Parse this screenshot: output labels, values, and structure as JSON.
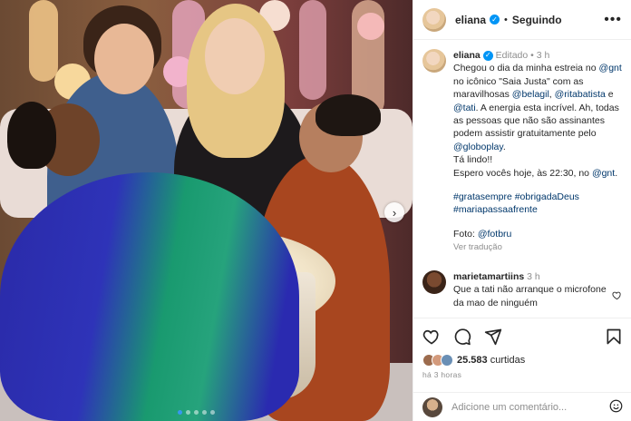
{
  "post": {
    "author": "eliana",
    "follow_status": "Seguindo",
    "more_label": "•••",
    "separator": "•"
  },
  "caption": {
    "author": "eliana",
    "edited_label": "Editado",
    "time": "3 h",
    "line1_pre": "Chegou o dia da minha estreia no ",
    "mention_gnt": "@gnt",
    "line1_mid": " no icônico \"Saia Justa\" com as maravilhosas ",
    "mention_belagil": "@belagil",
    "comma": ", ",
    "mention_ritabatista": "@ritabatista",
    "and": " e ",
    "mention_tati": "@tati",
    "line1_post": ". A energia esta incrível. Ah, todas as pessoas que não são assinantes podem assistir gratuitamente pelo ",
    "mention_globoplay": "@globoplay",
    "period": ".",
    "line2": "Tá lindo!!",
    "line3_pre": "Espero vocês hoje, às 22:30, no ",
    "line3_mention": "@gnt",
    "line3_post": ".",
    "hashtags_1": "#gratasempre #obrigadaDeus",
    "hashtags_2": "#mariapassaafrente",
    "photo_credit_pre": "Foto: ",
    "photo_credit_mention": "@fotbru",
    "see_translation": "Ver tradução"
  },
  "comment": {
    "user": "marietamartiins",
    "time": "3 h",
    "text": "Que a tati não arranque o microfone da mao de ninguém"
  },
  "actions": {
    "likes_count": "25.583",
    "likes_label": "curtidas",
    "posted_ago": "há 3 horas"
  },
  "add_comment": {
    "placeholder": "Adicione um comentário..."
  },
  "carousel": {
    "next_label": "›"
  },
  "colors": {
    "accent": "#0095f6",
    "link": "#00376b",
    "muted": "#8e8e8e",
    "text": "#262626"
  },
  "icons": [
    "verified-badge-icon",
    "more-options-icon",
    "heart-icon",
    "comment-icon",
    "share-icon",
    "bookmark-icon",
    "emoji-icon",
    "chevron-right-icon"
  ]
}
